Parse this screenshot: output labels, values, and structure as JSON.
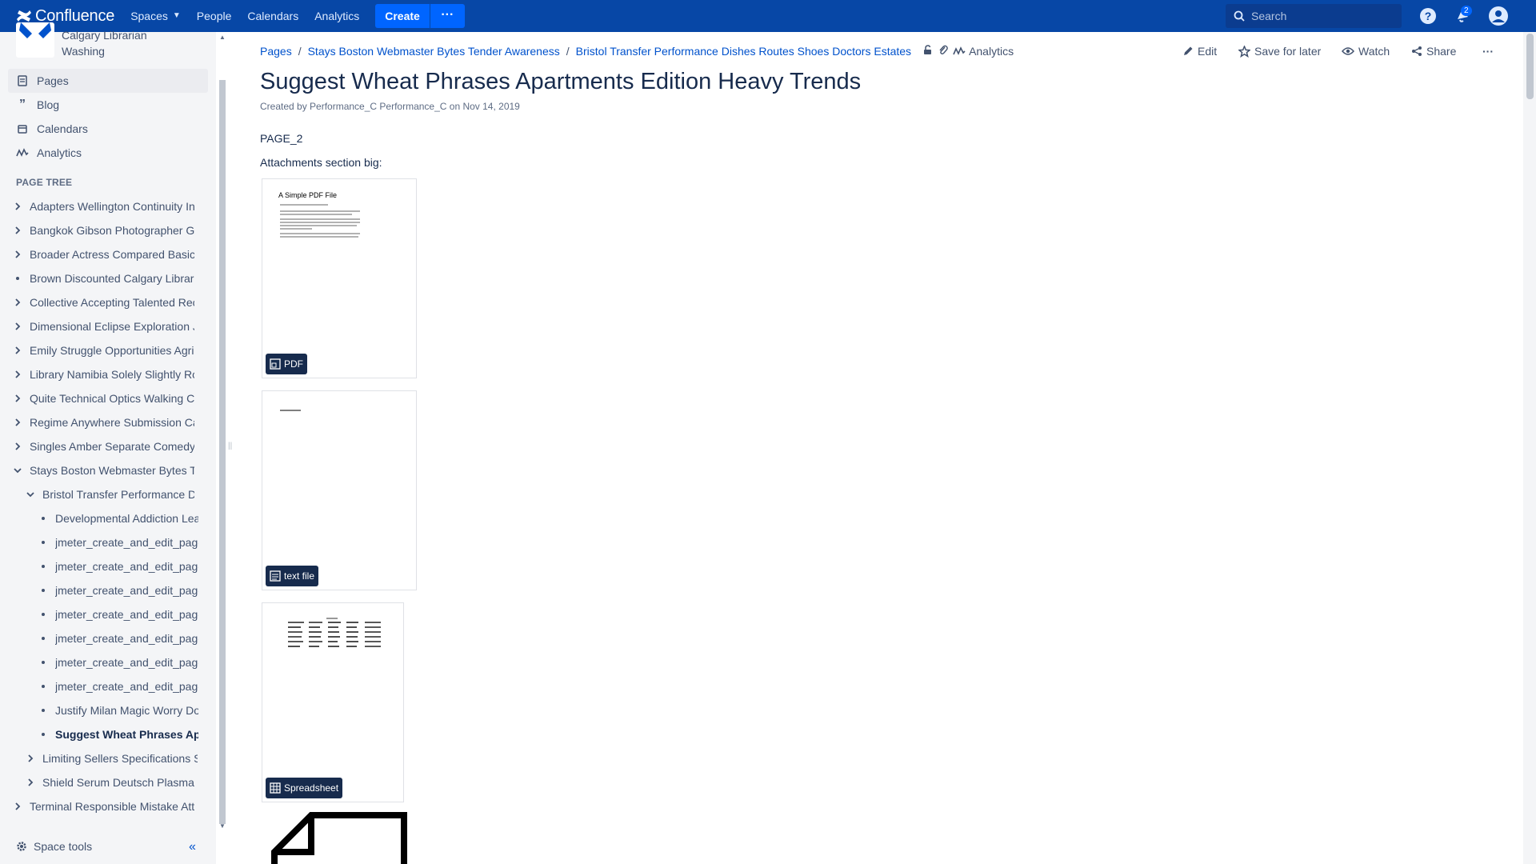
{
  "topbar": {
    "logo_text": "Confluence",
    "nav": {
      "spaces": "Spaces",
      "people": "People",
      "calendars": "Calendars",
      "analytics": "Analytics"
    },
    "create_label": "Create",
    "more_label": "···",
    "search_placeholder": "Search",
    "notification_count": "2",
    "brand_color": "#0747A6"
  },
  "sidebar": {
    "space_name": "Calgary Librarian Washing",
    "nav": {
      "pages": "Pages",
      "blog": "Blog",
      "calendars": "Calendars",
      "analytics": "Analytics"
    },
    "page_tree_title": "PAGE TREE",
    "tree": {
      "t1": "Adapters Wellington Continuity Inv",
      "t2": "Bangkok Gibson Photographer Gr",
      "t3": "Broader Actress Compared Basica",
      "t4": "Brown Discounted Calgary Librari",
      "t5": "Collective Accepting Talented Rec",
      "t6": "Dimensional Eclipse Exploration J",
      "t7": "Emily Struggle Opportunities Agric",
      "t8": "Library Namibia Solely Slightly Ro",
      "t9": "Quite Technical Optics Walking Co",
      "t10": "Regime Anywhere Submission Ca",
      "t11": "Singles Amber Separate Comedy",
      "t12": "Stays Boston Webmaster Bytes Te",
      "t13": "Bristol Transfer Performance Di",
      "t14": "Developmental Addiction Lea",
      "t15": "jmeter_create_and_edit_page",
      "t16": "jmeter_create_and_edit_page",
      "t17": "jmeter_create_and_edit_page",
      "t18": "jmeter_create_and_edit_page",
      "t19": "jmeter_create_and_edit_page",
      "t20": "jmeter_create_and_edit_page",
      "t21": "jmeter_create_and_edit_page",
      "t22": "Justify Milan Magic Worry Do",
      "t23": "Suggest Wheat Phrases Ap",
      "t24": "Limiting Sellers Specifications S",
      "t25": "Shield Serum Deutsch Plasma I",
      "t26": "Terminal Responsible Mistake Att"
    },
    "space_tools": "Space tools",
    "collapse_glyph": "«"
  },
  "breadcrumbs": {
    "b1": "Pages",
    "b2": "Stays Boston Webmaster Bytes Tender Awareness",
    "b3": "Bristol Transfer Performance Dishes Routes Shoes Doctors Estates",
    "analytics": "Analytics"
  },
  "actions": {
    "edit": "Edit",
    "save": "Save for later",
    "watch": "Watch",
    "share": "Share",
    "more": "···"
  },
  "page": {
    "title": "Suggest Wheat Phrases Apartments Edition Heavy Trends",
    "byline": "Created by Performance_C Performance_C on Nov 14, 2019",
    "body1": "PAGE_2",
    "body2": "Attachments section big:",
    "attachments": {
      "a1": {
        "tag": "PDF",
        "preview_title": "A Simple PDF File"
      },
      "a2": {
        "tag": "text file"
      },
      "a3": {
        "tag": "Spreadsheet"
      }
    }
  }
}
